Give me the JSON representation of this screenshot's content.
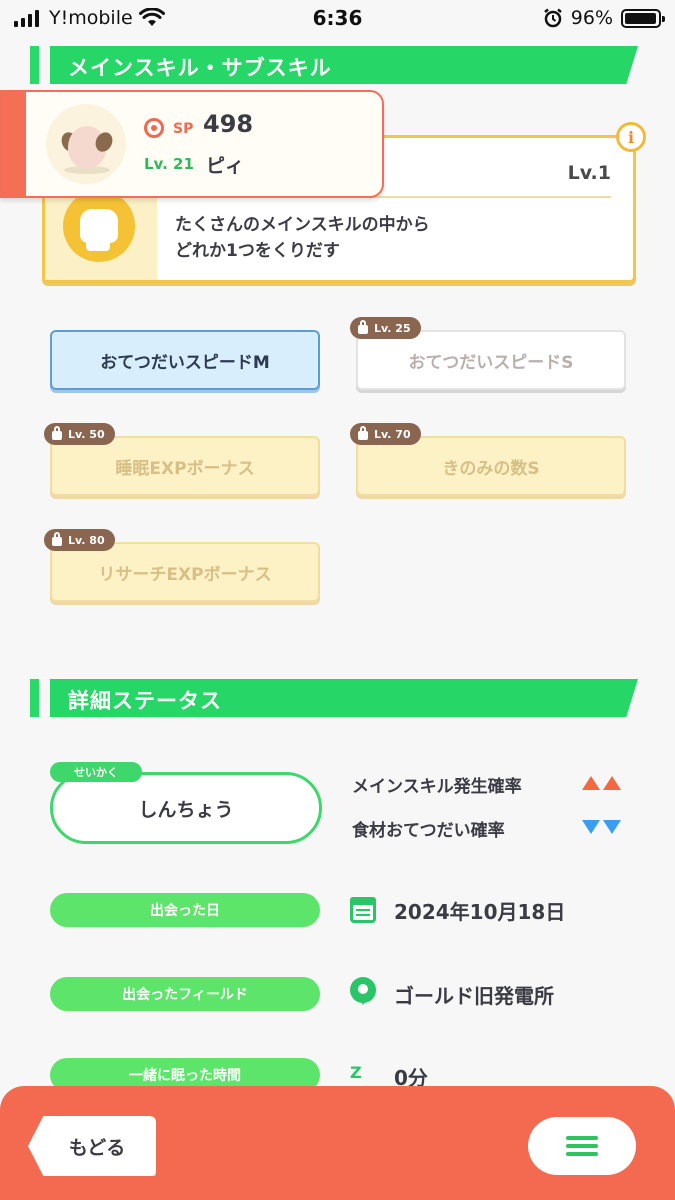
{
  "status_bar": {
    "carrier": "Y!mobile",
    "time": "6:36",
    "battery": "96%"
  },
  "main_skill_section": {
    "title": "メインスキル・サブスキル"
  },
  "pokemon": {
    "sp_label": "SP",
    "sp_value": "498",
    "level": "Lv. 21",
    "name": "ピィ"
  },
  "skill": {
    "level": "Lv.1",
    "description_line1": "たくさんのメインスキルの中から",
    "description_line2": "どれか1つをくりだす",
    "info_label": "i"
  },
  "subskills": [
    {
      "label": "おてつだいスピードM",
      "lock": "",
      "state": "active"
    },
    {
      "label": "おてつだいスピードS",
      "lock": "Lv. 25",
      "state": "locked"
    },
    {
      "label": "睡眠EXPボーナス",
      "lock": "Lv. 50",
      "state": "locked-gold"
    },
    {
      "label": "きのみの数S",
      "lock": "Lv. 70",
      "state": "locked-gold"
    },
    {
      "label": "リサーチEXPボーナス",
      "lock": "Lv. 80",
      "state": "locked-gold"
    }
  ],
  "details_section": {
    "title": "詳細ステータス"
  },
  "nature": {
    "tag": "せいかく",
    "value": "しんちょう",
    "up_label": "メインスキル発生確率",
    "down_label": "食材おてつだい確率"
  },
  "details": {
    "met_date_label": "出会った日",
    "met_date_value": "2024年10月18日",
    "met_field_label": "出会ったフィールド",
    "met_field_value": "ゴールド旧発電所",
    "slept_label": "一緒に眠った時間",
    "slept_icon": "Z z z",
    "slept_value": "0分"
  },
  "bottom": {
    "back_label": "もどる"
  },
  "colors": {
    "accent_green": "#26d767",
    "bottom_bar": "#f46a51",
    "gold": "#f3c64a"
  }
}
